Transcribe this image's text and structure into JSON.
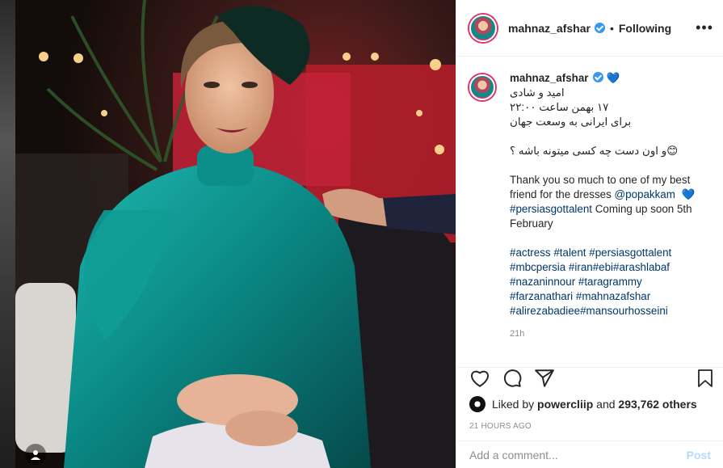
{
  "post": {
    "username": "mahnaz_afshar",
    "follow_status": "Following",
    "more_label": "•••",
    "caption": {
      "line1": "امید و شادی",
      "line2": "۱۷ بهمن ساعت ۲۲:۰۰",
      "line3": "برای ایرانی به وسعت جهان",
      "line4": "و اون دست چه کسی میتونه باشه ؟",
      "thanks_text": "Thank you so much to one of my best friend for the dresses",
      "thanks_mention": "@popakkam",
      "coming_tag": "#persiasgottalent",
      "coming_text": " Coming up soon 5th February",
      "tags_line1": "#actress #talent #persiasgottalent",
      "tags_line2": "#mbcpersia #iran#ebi#arashlabaf",
      "tags_line3": "#nazaninnour #taragrammy",
      "tags_line4": "#farzanathari #mahnazafshar",
      "tags_line5": "#alirezabadiee#mansourhosseini"
    },
    "caption_age": "21h",
    "liked_by_prefix": "Liked by ",
    "liked_by_user": "powercliip",
    "liked_by_and": " and ",
    "liked_by_count": "293,762 others",
    "timestamp": "21 HOURS AGO",
    "comment_placeholder": "Add a comment...",
    "post_button": "Post"
  },
  "icons": {
    "verified": "verified-badge-icon",
    "heart_emoji": "blue-heart-icon",
    "like": "heart-icon",
    "comment": "comment-icon",
    "share": "send-icon",
    "save": "bookmark-icon",
    "multi": "user-tag-icon"
  },
  "colors": {
    "link": "#00376b",
    "verified": "#3897f0",
    "muted": "#8e8e8e",
    "post_disabled": "#b3dbff"
  }
}
